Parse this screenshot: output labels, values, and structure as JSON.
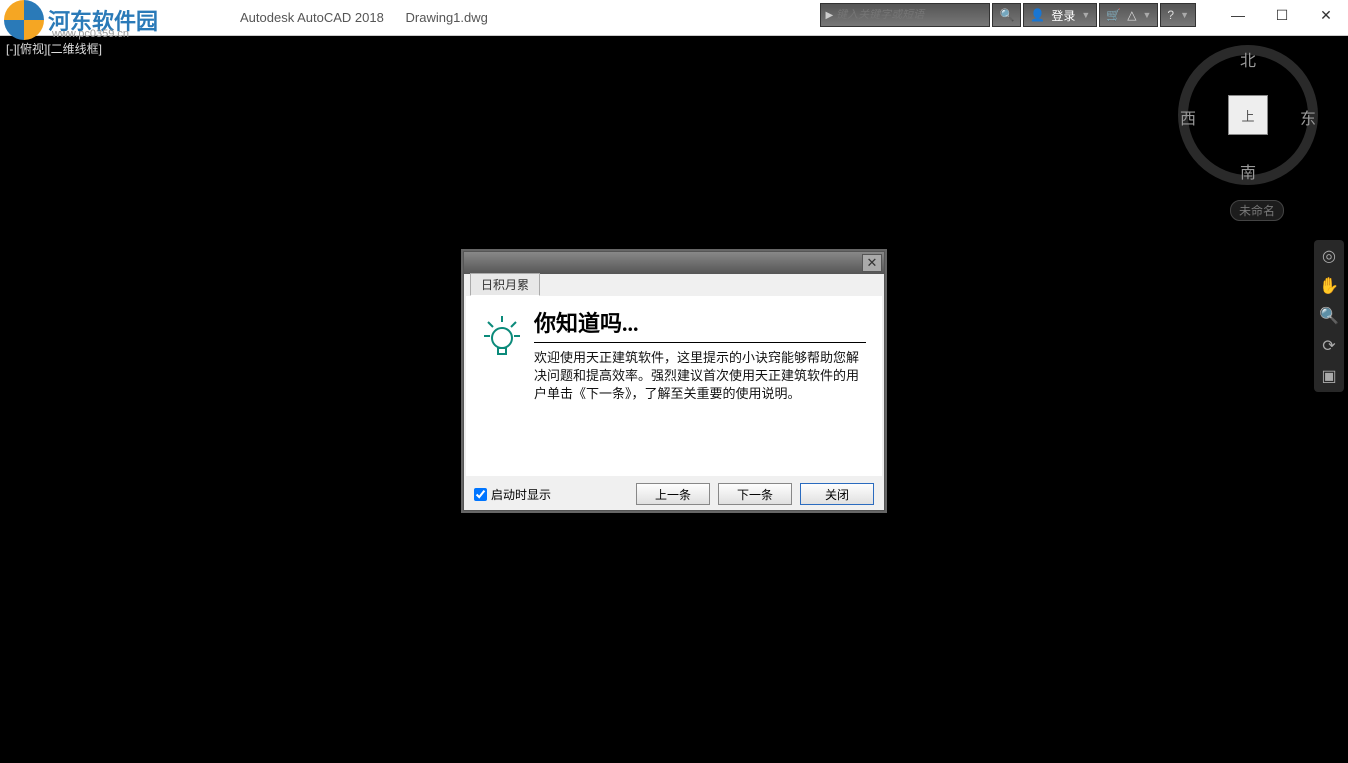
{
  "titlebar": {
    "logo_text": "河东软件园",
    "logo_sub": "www.pc0359.cn",
    "app_title": "Autodesk AutoCAD 2018",
    "doc_title": "Drawing1.dwg",
    "search_placeholder": "键入关键字或短语",
    "login_label": "登录"
  },
  "view": {
    "label": "[-][俯视][二维线框]"
  },
  "viewcube": {
    "face": "上",
    "north": "北",
    "south": "南",
    "east": "东",
    "west": "西",
    "unnamed": "未命名"
  },
  "dialog": {
    "tab": "日积月累",
    "heading": "你知道吗...",
    "body": "欢迎使用天正建筑软件，这里提示的小诀窍能够帮助您解决问题和提高效率。强烈建议首次使用天正建筑软件的用户单击《下一条》，了解至关重要的使用说明。",
    "show_on_start": "启动时显示",
    "prev": "上一条",
    "next": "下一条",
    "close": "关闭"
  }
}
